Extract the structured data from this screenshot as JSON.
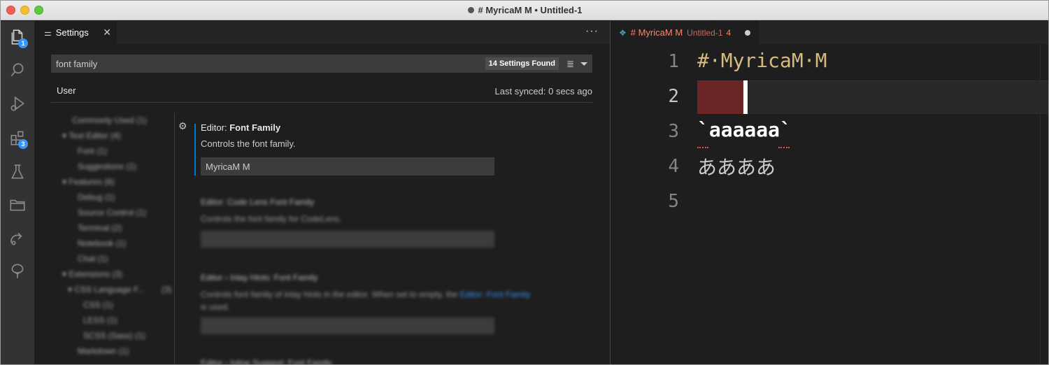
{
  "window": {
    "title": "# MyricaM M • Untitled-1"
  },
  "activity_bar": {
    "items": [
      {
        "name": "explorer",
        "badge": "1"
      },
      {
        "name": "search"
      },
      {
        "name": "run-debug"
      },
      {
        "name": "extensions",
        "badge": "3"
      },
      {
        "name": "testing"
      },
      {
        "name": "folders"
      },
      {
        "name": "remote"
      },
      {
        "name": "tree"
      }
    ]
  },
  "settings": {
    "tab_label": "Settings",
    "search_value": "font family",
    "found_count": "14 Settings Found",
    "scope_tab": "User",
    "last_synced": "Last synced: 0 secs ago",
    "toc": [
      "Commonly Used (1)",
      "Text Editor (4)",
      "Font (1)",
      "Suggestions (1)",
      "Features (6)",
      "Debug (1)",
      "Source Control (1)",
      "Terminal (2)",
      "Notebook (1)",
      "Chat (1)",
      "Extensions (3)",
      "CSS Language F...",
      "(3)",
      "CSS (1)",
      "LESS (1)",
      "SCSS (Sass) (1)",
      "Markdown (1)"
    ],
    "item_main": {
      "prefix": "Editor: ",
      "title": "Font Family",
      "description": "Controls the font family.",
      "value": "MyricaM M"
    },
    "item2": {
      "title": "Editor: Code Lens Font Family",
      "description": "Controls the font family for CodeLens."
    },
    "item3": {
      "title": "Editor › Inlay Hints: Font Family",
      "description": "Controls font family of inlay hints in the editor. When set to empty, the",
      "link": "Editor: Font Family",
      "description2": "is used."
    },
    "item4": {
      "title": "Editor › Inline Suggest: Font Family"
    }
  },
  "editor": {
    "tab": {
      "title": "# MyricaM M",
      "description": "Untitled-1",
      "problems": "4"
    },
    "line_numbers": [
      "1",
      "2",
      "3",
      "4",
      "5"
    ],
    "lines": {
      "l1": "# MyricaM M",
      "l1_display": "#·MyricaM·M",
      "l3": "`aaaaaa`",
      "l4": "ああああ"
    }
  },
  "colors": {
    "accent": "#007acc",
    "badge": "#3794ff",
    "heading": "#d7ba7d",
    "error": "#f14c4c",
    "selection": "#6b2527"
  }
}
